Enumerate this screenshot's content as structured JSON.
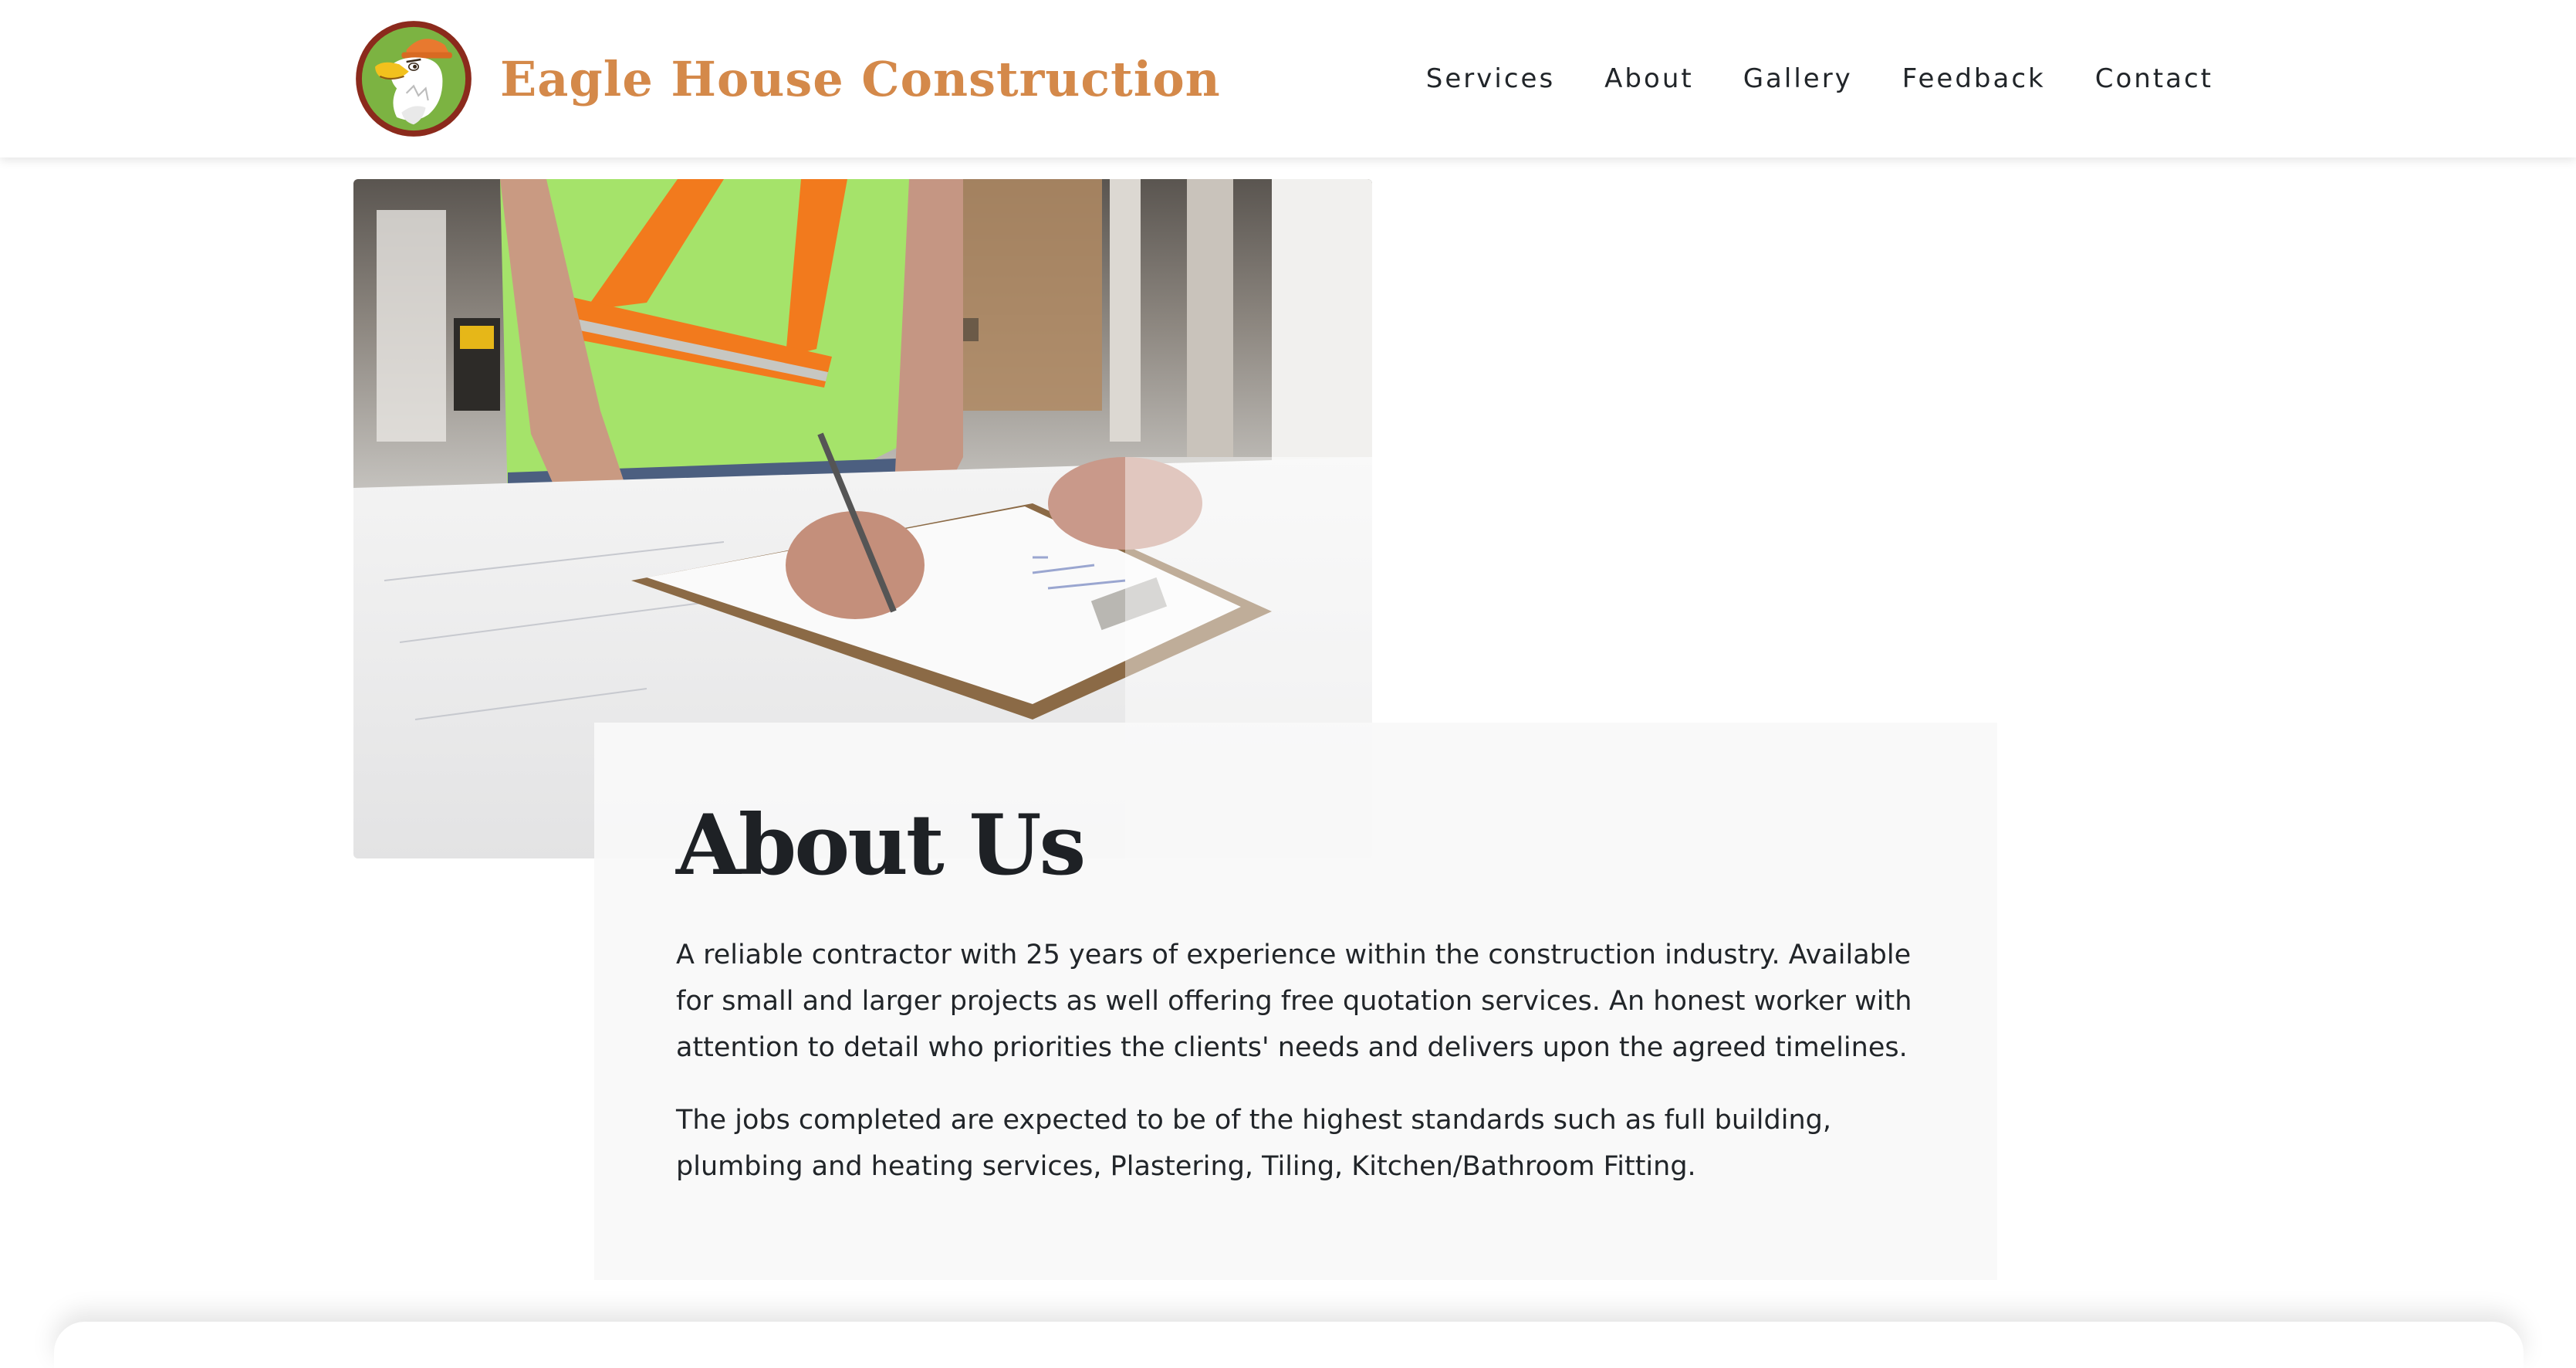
{
  "brand": {
    "name": "Eagle House Construction",
    "logo_icon": "eagle-logo-icon",
    "colors": {
      "accent": "#d4894a",
      "logo_ring": "#8b2a1c",
      "logo_bg": "#7cb342"
    }
  },
  "nav": {
    "items": [
      {
        "label": "Services"
      },
      {
        "label": "About"
      },
      {
        "label": "Gallery"
      },
      {
        "label": "Feedback"
      },
      {
        "label": "Contact"
      }
    ]
  },
  "hero": {
    "image": "construction-worker-writing-on-clipboard"
  },
  "about": {
    "title": "About Us",
    "paragraphs": [
      "A reliable contractor with 25 years of experience within the construction industry. Available for small and larger projects as well offering free quotation services. An honest worker with attention to detail who priorities the clients' needs and delivers upon the agreed timelines.",
      "The jobs completed are expected to be of the highest standards such as full building, plumbing and heating services, Plastering, Tiling, Kitchen/Bathroom Fitting."
    ]
  }
}
